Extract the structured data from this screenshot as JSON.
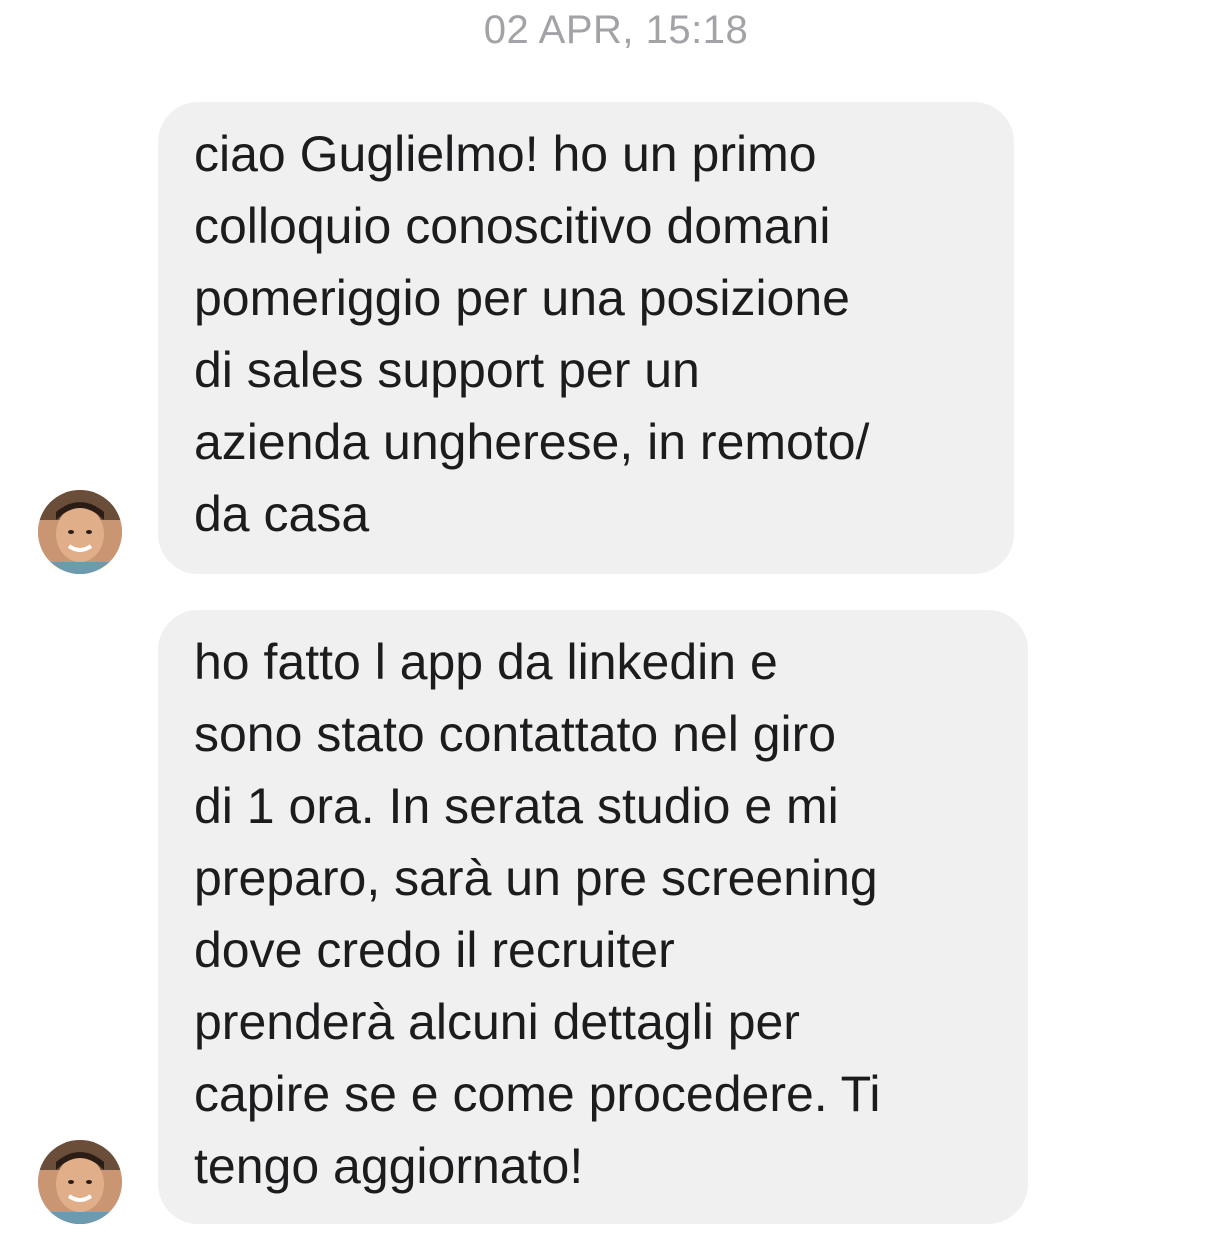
{
  "conversation": {
    "timestamp": "02 APR, 15:18",
    "messages": [
      {
        "sender": "contact",
        "text": "ciao Guglielmo! ho un primo\ncolloquio conoscitivo domani\npomeriggio per una posizione\ndi sales support per un\nazienda ungherese, in remoto/\nda casa"
      },
      {
        "sender": "contact",
        "text": "ho fatto l app da linkedin e\nsono stato contattato nel giro\ndi 1 ora. In serata studio e mi\npreparo, sarà un pre screening\ndove credo il recruiter\nprenderà alcuni dettagli per\ncapire se e come procedere. Ti\ntengo aggiornato!"
      }
    ]
  },
  "colors": {
    "bubble_background": "#f0f0f0",
    "timestamp_text": "#a2a2a7",
    "message_text": "#1c1c1e"
  }
}
